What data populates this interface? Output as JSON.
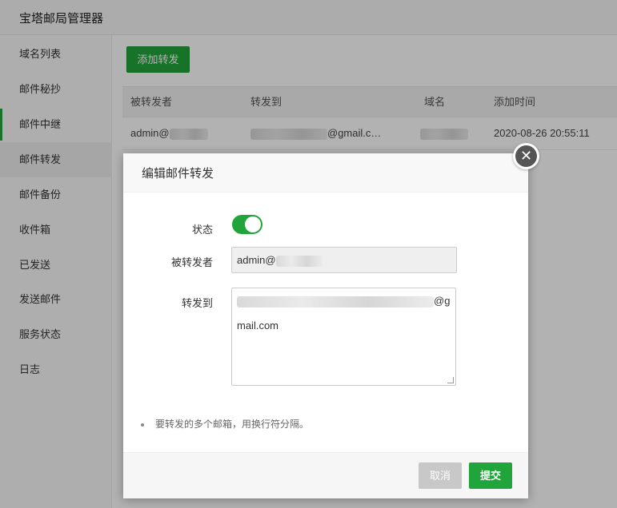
{
  "app": {
    "title": "宝塔邮局管理器"
  },
  "sidebar": {
    "items": [
      {
        "label": "域名列表"
      },
      {
        "label": "邮件秘抄"
      },
      {
        "label": "邮件中继"
      },
      {
        "label": "邮件转发"
      },
      {
        "label": "邮件备份"
      },
      {
        "label": "收件箱"
      },
      {
        "label": "已发送"
      },
      {
        "label": "发送邮件"
      },
      {
        "label": "服务状态"
      },
      {
        "label": "日志"
      }
    ],
    "active_index": 3
  },
  "main": {
    "add_button_label": "添加转发",
    "table": {
      "columns": [
        "被转发者",
        "转发到",
        "域名",
        "添加时间"
      ],
      "rows": [
        {
          "forwarder": "admin@",
          "forward_to": "@gmail.c…",
          "domain": "",
          "added_time": "2020-08-26 20:55:11"
        }
      ]
    }
  },
  "modal": {
    "title": "编辑邮件转发",
    "close_icon": "close-icon",
    "fields": {
      "status_label": "状态",
      "status_on": true,
      "forwarder_label": "被转发者",
      "forwarder_value": "admin@",
      "forward_to_label": "转发到",
      "forward_to_line1_suffix": "@g",
      "forward_to_line2": "mail.com"
    },
    "tip": "要转发的多个邮箱，用换行符分隔。",
    "cancel_label": "取消",
    "submit_label": "提交"
  },
  "colors": {
    "accent": "#20a53a",
    "cancel": "#c8c8c8",
    "overlay": "rgba(0,0,0,0.3)"
  }
}
